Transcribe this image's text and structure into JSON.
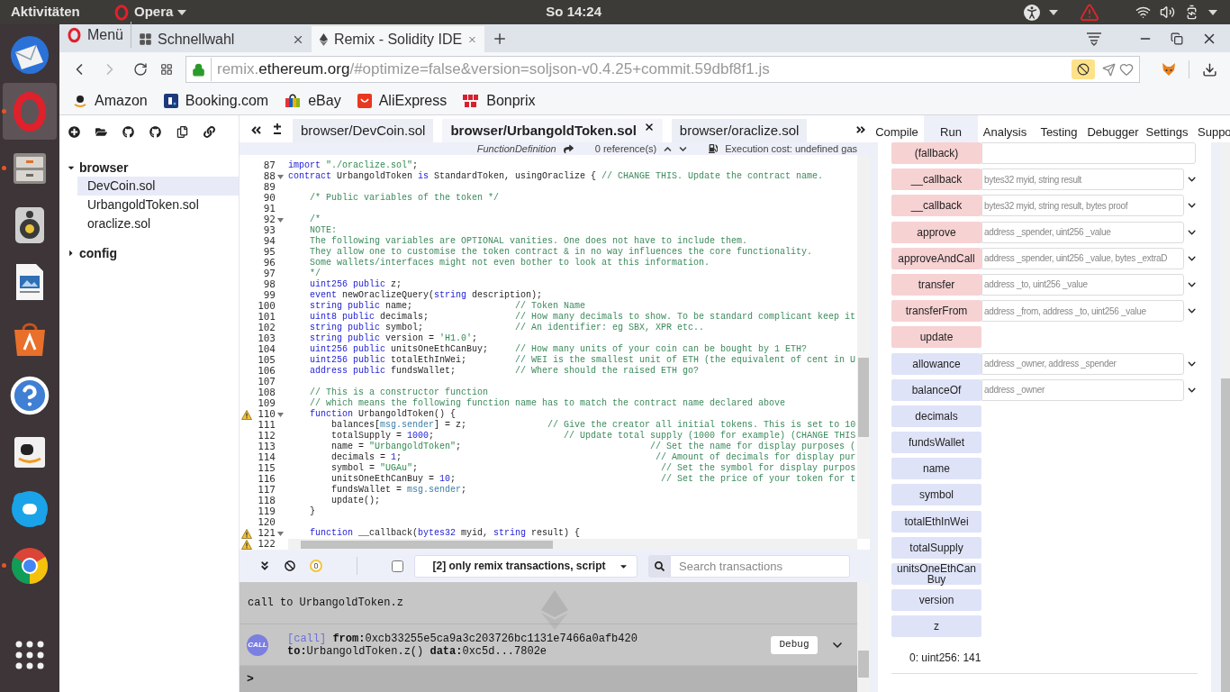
{
  "system_bar": {
    "activities": "Aktivitäten",
    "app": "Opera",
    "clock": "So 14:24"
  },
  "dock": [
    {
      "kind": "mail",
      "running": false,
      "selected": false
    },
    {
      "kind": "ring",
      "running": true,
      "selected": true
    },
    {
      "kind": "cabinet",
      "running": true,
      "selected": false
    },
    {
      "kind": "speaker",
      "running": false,
      "selected": false
    },
    {
      "kind": "slides",
      "running": false,
      "selected": false
    },
    {
      "kind": "bag",
      "running": false,
      "selected": false
    },
    {
      "kind": "help",
      "running": false,
      "selected": false
    },
    {
      "kind": "box",
      "running": false,
      "selected": false
    },
    {
      "kind": "chat",
      "running": false,
      "selected": false
    },
    {
      "kind": "wheel",
      "running": true,
      "selected": false
    },
    {
      "kind": "grid",
      "running": false,
      "selected": false
    }
  ],
  "browser": {
    "tabs": [
      {
        "kind": "menu",
        "label": "Menü",
        "selected": false
      },
      {
        "kind": "speed-dial",
        "label": "Schnellwahl",
        "selected": false
      },
      {
        "kind": "page",
        "label": "Remix - Solidity IDE",
        "selected": true
      }
    ],
    "forward_disabled": true,
    "address": {
      "host_prefix": "remix.",
      "domain": "ethereum.org",
      "path": "/#optimize=false&version=soljson-v0.4.25+commit.59dbf8f1.js"
    },
    "ad_block_on": true,
    "bookmarks": [
      {
        "kind": "smile",
        "label": "Amazon"
      },
      {
        "kind": "square",
        "label": "Booking.com"
      },
      {
        "kind": "bag",
        "label": "eBay"
      },
      {
        "kind": "ribbon",
        "label": "AliExpress"
      },
      {
        "kind": "tiles",
        "label": "Bonprix"
      }
    ]
  },
  "explorer": {
    "tree": [
      {
        "label": "browser",
        "expanded": true,
        "selected": false,
        "children": [
          {
            "label": "DevCoin.sol",
            "selected": true
          },
          {
            "label": "UrbangoldToken.sol",
            "selected": false
          },
          {
            "label": "oraclize.sol",
            "selected": false
          }
        ]
      },
      {
        "label": "config",
        "expanded": false,
        "selected": false
      }
    ]
  },
  "editor": {
    "tabs": [
      {
        "label": "browser/DevCoin.sol",
        "selected": false
      },
      {
        "label": "browser/UrbangoldToken.sol",
        "selected": true
      },
      {
        "label": "browser/oraclize.sol",
        "selected": false
      }
    ],
    "context": {
      "node": "FunctionDefinition",
      "references": "0 reference(s)",
      "cost": "Execution cost: undefined gas"
    },
    "lines": [
      {
        "number": "87",
        "warning": false,
        "fold": false,
        "tokens": [
          {
            "kind": "keyword",
            "text": "import"
          },
          {
            "kind": "string",
            "text": " \"./oraclize.sol\""
          },
          {
            "kind": "plain",
            "text": ";"
          }
        ]
      },
      {
        "number": "88",
        "warning": false,
        "fold": true,
        "tokens": [
          {
            "kind": "keyword",
            "text": "contract"
          },
          {
            "kind": "plain",
            "text": " UrbangoldToken "
          },
          {
            "kind": "keyword",
            "text": "is"
          },
          {
            "kind": "plain",
            "text": " StandardToken, usingOraclize { "
          },
          {
            "kind": "comment",
            "text": "// CHANGE THIS. Update the contract name."
          }
        ]
      },
      {
        "number": "89",
        "warning": false,
        "fold": false
      },
      {
        "number": "90",
        "warning": false,
        "fold": false,
        "tokens": [
          {
            "kind": "comment",
            "text": "    /* Public variables of the token */"
          }
        ]
      },
      {
        "number": "91",
        "warning": false,
        "fold": false
      },
      {
        "number": "92",
        "warning": false,
        "fold": true,
        "tokens": [
          {
            "kind": "comment",
            "text": "    /*"
          }
        ]
      },
      {
        "number": "93",
        "warning": false,
        "fold": false,
        "tokens": [
          {
            "kind": "comment",
            "text": "    NOTE:"
          }
        ]
      },
      {
        "number": "94",
        "warning": false,
        "fold": false,
        "tokens": [
          {
            "kind": "comment",
            "text": "    The following variables are OPTIONAL vanities. One does not have to include them."
          }
        ]
      },
      {
        "number": "95",
        "warning": false,
        "fold": false,
        "tokens": [
          {
            "kind": "comment",
            "text": "    They allow one to customise the token contract & in no way influences the core functionality."
          }
        ]
      },
      {
        "number": "96",
        "warning": false,
        "fold": false,
        "tokens": [
          {
            "kind": "comment",
            "text": "    Some wallets/interfaces might not even bother to look at this information."
          }
        ]
      },
      {
        "number": "97",
        "warning": false,
        "fold": false,
        "tokens": [
          {
            "kind": "comment",
            "text": "    */"
          }
        ]
      },
      {
        "number": "98",
        "warning": false,
        "fold": false,
        "tokens": [
          {
            "kind": "keyword",
            "text": "    uint256"
          },
          {
            "kind": "keyword",
            "text": " public"
          },
          {
            "kind": "plain",
            "text": " z;"
          }
        ]
      },
      {
        "number": "99",
        "warning": false,
        "fold": false,
        "tokens": [
          {
            "kind": "keyword",
            "text": "    event"
          },
          {
            "kind": "plain",
            "text": " newOraclizeQuery("
          },
          {
            "kind": "keyword",
            "text": "string"
          },
          {
            "kind": "plain",
            "text": " description);"
          }
        ]
      },
      {
        "number": "100",
        "warning": false,
        "fold": false,
        "tokens": [
          {
            "kind": "keyword",
            "text": "    string"
          },
          {
            "kind": "keyword",
            "text": " public"
          },
          {
            "kind": "plain",
            "text": " name;                   "
          },
          {
            "kind": "comment",
            "text": "// Token Name"
          }
        ]
      },
      {
        "number": "101",
        "warning": false,
        "fold": false,
        "tokens": [
          {
            "kind": "keyword",
            "text": "    uint8"
          },
          {
            "kind": "keyword",
            "text": " public"
          },
          {
            "kind": "plain",
            "text": " decimals;                "
          },
          {
            "kind": "comment",
            "text": "// How many decimals to show. To be standard complicant keep it"
          }
        ]
      },
      {
        "number": "102",
        "warning": false,
        "fold": false,
        "tokens": [
          {
            "kind": "keyword",
            "text": "    string"
          },
          {
            "kind": "keyword",
            "text": " public"
          },
          {
            "kind": "plain",
            "text": " symbol;                 "
          },
          {
            "kind": "comment",
            "text": "// An identifier: eg SBX, XPR etc.."
          }
        ]
      },
      {
        "number": "103",
        "warning": false,
        "fold": false,
        "tokens": [
          {
            "kind": "keyword",
            "text": "    string"
          },
          {
            "kind": "keyword",
            "text": " public"
          },
          {
            "kind": "plain",
            "text": " version = "
          },
          {
            "kind": "string",
            "text": "'H1.0'"
          },
          {
            "kind": "plain",
            "text": ";"
          }
        ]
      },
      {
        "number": "104",
        "warning": false,
        "fold": false,
        "tokens": [
          {
            "kind": "keyword",
            "text": "    uint256"
          },
          {
            "kind": "keyword",
            "text": " public"
          },
          {
            "kind": "plain",
            "text": " unitsOneEthCanBuy;     "
          },
          {
            "kind": "comment",
            "text": "// How many units of your coin can be bought by 1 ETH?"
          }
        ]
      },
      {
        "number": "105",
        "warning": false,
        "fold": false,
        "tokens": [
          {
            "kind": "keyword",
            "text": "    uint256"
          },
          {
            "kind": "keyword",
            "text": " public"
          },
          {
            "kind": "plain",
            "text": " totalEthInWei;         "
          },
          {
            "kind": "comment",
            "text": "// WEI is the smallest unit of ETH (the equivalent of cent in U"
          }
        ]
      },
      {
        "number": "106",
        "warning": false,
        "fold": false,
        "tokens": [
          {
            "kind": "keyword",
            "text": "    address"
          },
          {
            "kind": "keyword",
            "text": " public"
          },
          {
            "kind": "plain",
            "text": " fundsWallet;           "
          },
          {
            "kind": "comment",
            "text": "// Where should the raised ETH go?"
          }
        ]
      },
      {
        "number": "107",
        "warning": false,
        "fold": false
      },
      {
        "number": "108",
        "warning": false,
        "fold": false,
        "tokens": [
          {
            "kind": "comment",
            "text": "    // This is a constructor function"
          }
        ]
      },
      {
        "number": "109",
        "warning": false,
        "fold": false,
        "tokens": [
          {
            "kind": "comment",
            "text": "    // which means the following function name has to match the contract name declared above"
          }
        ]
      },
      {
        "number": "110",
        "warning": true,
        "fold": true,
        "tokens": [
          {
            "kind": "keyword",
            "text": "    function"
          },
          {
            "kind": "plain",
            "text": " UrbangoldToken() {"
          }
        ]
      },
      {
        "number": "111",
        "warning": false,
        "fold": false,
        "tokens": [
          {
            "kind": "plain",
            "text": "        balances["
          },
          {
            "kind": "member",
            "text": "msg.sender"
          },
          {
            "kind": "plain",
            "text": "] = z;               "
          },
          {
            "kind": "comment",
            "text": "// Give the creator all initial tokens. This is set to 10"
          }
        ]
      },
      {
        "number": "112",
        "warning": false,
        "fold": false,
        "tokens": [
          {
            "kind": "plain",
            "text": "        totalSupply = "
          },
          {
            "kind": "number",
            "text": "1000"
          },
          {
            "kind": "plain",
            "text": ";                        "
          },
          {
            "kind": "comment",
            "text": "// Update total supply (1000 for example) (CHANGE THIS"
          }
        ]
      },
      {
        "number": "113",
        "warning": false,
        "fold": false,
        "tokens": [
          {
            "kind": "plain",
            "text": "        name = "
          },
          {
            "kind": "string",
            "text": "\"UrbangoldToken\""
          },
          {
            "kind": "plain",
            "text": ";                                   "
          },
          {
            "kind": "comment",
            "text": "// Set the name for display purposes ("
          }
        ]
      },
      {
        "number": "114",
        "warning": false,
        "fold": false,
        "tokens": [
          {
            "kind": "plain",
            "text": "        decimals = "
          },
          {
            "kind": "number",
            "text": "1"
          },
          {
            "kind": "plain",
            "text": ";                                               "
          },
          {
            "kind": "comment",
            "text": "// Amount of decimals for display pur"
          }
        ]
      },
      {
        "number": "115",
        "warning": false,
        "fold": false,
        "tokens": [
          {
            "kind": "plain",
            "text": "        symbol = "
          },
          {
            "kind": "string",
            "text": "\"UGAu\""
          },
          {
            "kind": "plain",
            "text": ";                                             "
          },
          {
            "kind": "comment",
            "text": "// Set the symbol for display purpos"
          }
        ]
      },
      {
        "number": "116",
        "warning": false,
        "fold": false,
        "tokens": [
          {
            "kind": "plain",
            "text": "        unitsOneEthCanBuy = "
          },
          {
            "kind": "number",
            "text": "10"
          },
          {
            "kind": "plain",
            "text": ";                                      "
          },
          {
            "kind": "comment",
            "text": "// Set the price of your token for t"
          }
        ]
      },
      {
        "number": "117",
        "warning": false,
        "fold": false,
        "tokens": [
          {
            "kind": "plain",
            "text": "        fundsWallet = "
          },
          {
            "kind": "member",
            "text": "msg.sender"
          },
          {
            "kind": "plain",
            "text": ";"
          }
        ]
      },
      {
        "number": "118",
        "warning": false,
        "fold": false,
        "tokens": [
          {
            "kind": "plain",
            "text": "        update();"
          }
        ]
      },
      {
        "number": "119",
        "warning": false,
        "fold": false,
        "tokens": [
          {
            "kind": "plain",
            "text": "    }"
          }
        ]
      },
      {
        "number": "120",
        "warning": false,
        "fold": false
      },
      {
        "number": "121",
        "warning": true,
        "fold": true,
        "tokens": [
          {
            "kind": "keyword",
            "text": "    function"
          },
          {
            "kind": "plain",
            "text": " __callback("
          },
          {
            "kind": "keyword",
            "text": "bytes32"
          },
          {
            "kind": "plain",
            "text": " myid, "
          },
          {
            "kind": "keyword",
            "text": "string"
          },
          {
            "kind": "plain",
            "text": " result) {"
          }
        ]
      },
      {
        "number": "122",
        "warning": true,
        "fold": false
      }
    ]
  },
  "terminal": {
    "pending": "0",
    "filter_checked": false,
    "filter": "[2] only remix transactions, script",
    "search_placeholder": "Search transactions",
    "log": "call to UrbangoldToken.z",
    "call": {
      "badge": "CALL",
      "tag": "[call]",
      "from_label": "from:",
      "from": "0xcb33255e5ca9a3c203726bc1131e7466a0afb420",
      "to_label": "to:",
      "to": "UrbangoldToken.z()",
      "data_label": "data:",
      "data": "0xc5d...7802e",
      "button": "Debug"
    },
    "prompt": ">"
  },
  "panel": {
    "tabs": [
      {
        "label": "Compile",
        "selected": false
      },
      {
        "label": "Run",
        "selected": true
      },
      {
        "label": "Analysis",
        "selected": false
      },
      {
        "label": "Testing",
        "selected": false
      },
      {
        "label": "Debugger",
        "selected": false
      },
      {
        "label": "Settings",
        "selected": false
      },
      {
        "label": "Suppo",
        "selected": false
      }
    ],
    "functions": [
      {
        "name": "(fallback)",
        "kind": "transact",
        "field": true
      },
      {
        "name": "__callback",
        "kind": "transact",
        "field": true,
        "placeholder": "bytes32 myid, string result"
      },
      {
        "name": "__callback",
        "kind": "transact",
        "field": true,
        "placeholder": "bytes32 myid, string result, bytes proof"
      },
      {
        "name": "approve",
        "kind": "transact",
        "field": true,
        "placeholder": "address _spender, uint256 _value"
      },
      {
        "name": "approveAndCall",
        "kind": "transact",
        "field": true,
        "placeholder": "address _spender, uint256 _value, bytes _extraD"
      },
      {
        "name": "transfer",
        "kind": "transact",
        "field": true,
        "placeholder": "address _to, uint256 _value"
      },
      {
        "name": "transferFrom",
        "kind": "transact",
        "field": true,
        "placeholder": "address _from, address _to, uint256 _value"
      },
      {
        "name": "update",
        "kind": "transact",
        "field": false
      },
      {
        "name": "allowance",
        "kind": "call",
        "field": true,
        "placeholder": "address _owner, address _spender"
      },
      {
        "name": "balanceOf",
        "kind": "call",
        "field": true,
        "placeholder": "address _owner"
      },
      {
        "name": "decimals",
        "kind": "call",
        "field": false
      },
      {
        "name": "fundsWallet",
        "kind": "call",
        "field": false
      },
      {
        "name": "name",
        "kind": "call",
        "field": false
      },
      {
        "name": "symbol",
        "kind": "call",
        "field": false
      },
      {
        "name": "totalEthInWei",
        "kind": "call",
        "field": false
      },
      {
        "name": "totalSupply",
        "kind": "call",
        "field": false
      },
      {
        "name": "unitsOneEthCanBuy",
        "kind": "call",
        "field": false
      },
      {
        "name": "version",
        "kind": "call",
        "field": false
      },
      {
        "name": "z",
        "kind": "call",
        "field": false
      }
    ],
    "output": "0: uint256: 141"
  }
}
